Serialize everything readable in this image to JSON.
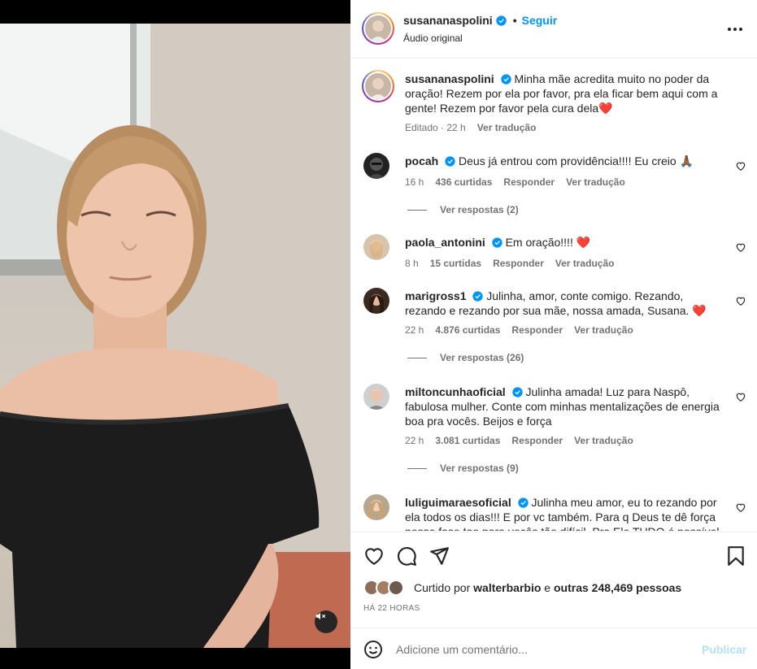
{
  "post": {
    "username": "susananaspolini",
    "follow_label": "Seguir",
    "separator": "•",
    "audio_label": "Áudio original"
  },
  "caption": {
    "username": "susananaspolini",
    "text": "Minha mãe acredita muito no poder da oração! Rezem por ela por favor, pra ela ficar bem aqui com a gente! Rezem por favor pela cura dela",
    "emoji": "❤️",
    "edited": "Editado · 22 h",
    "translate": "Ver tradução"
  },
  "comments": [
    {
      "username": "pocah",
      "text": "Deus já entrou com providência!!!! Eu creio",
      "emoji": "🙏🏾",
      "time": "16 h",
      "likes": "436 curtidas",
      "reply": "Responder",
      "translate": "Ver tradução",
      "replies": "Ver respostas (2)"
    },
    {
      "username": "paola_antonini",
      "text": "Em oração!!!!",
      "emoji": "❤️",
      "time": "8 h",
      "likes": "15 curtidas",
      "reply": "Responder",
      "translate": "Ver tradução"
    },
    {
      "username": "marigross1",
      "text": "Julinha, amor, conte comigo. Rezando, rezando e rezando por sua mãe, nossa amada, Susana.",
      "emoji": "❤️",
      "time": "22 h",
      "likes": "4.876 curtidas",
      "reply": "Responder",
      "translate": "Ver tradução",
      "replies": "Ver respostas (26)"
    },
    {
      "username": "miltoncunhaoficial",
      "text": "Julinha amada! Luz para Naspô, fabulosa mulher. Conte com minhas mentalizações de energia boa pra vocês. Beijos e força",
      "time": "22 h",
      "likes": "3.081 curtidas",
      "reply": "Responder",
      "translate": "Ver tradução",
      "replies": "Ver respostas (9)"
    },
    {
      "username": "luliguimaraesoficial",
      "text": "Julinha meu amor, eu to rezando por ela todos os dias!!! E por vc também. Para q Deus te dê força nesse fase tao para vocês tão difícil. Pra Ele TUDO é possível"
    }
  ],
  "likes_bar": {
    "liked_by_prefix": "Curtido por",
    "liked_by_user": "walterbarbio",
    "and_others": "e",
    "others_label": "outras 248,469 pessoas",
    "time_ago": "HÁ 22 HORAS"
  },
  "add_comment": {
    "placeholder": "Adicione um comentário...",
    "post_label": "Publicar"
  },
  "icons": {
    "verified": "verified-badge-icon",
    "more": "more-options-icon",
    "like": "heart-icon",
    "comment": "comment-icon",
    "share": "share-icon",
    "save": "bookmark-icon",
    "emoji": "emoji-icon",
    "mute": "speaker-muted-icon"
  },
  "colors": {
    "accent": "#0095f6",
    "text": "#262626",
    "secondary": "#737373",
    "heart": "#ed4956",
    "post_disabled": "#b2dffc"
  }
}
